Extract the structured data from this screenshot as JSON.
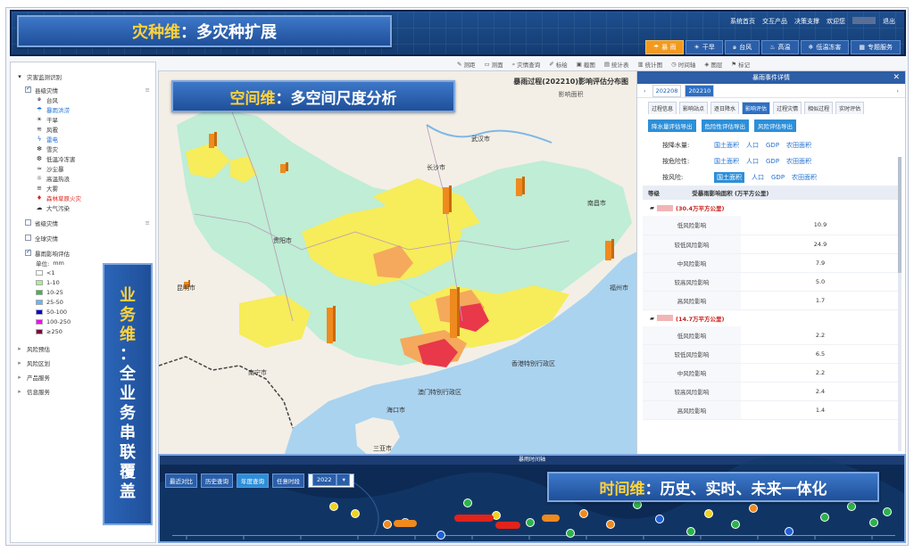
{
  "header": {
    "banner_prefix": "灾种维",
    "banner_colon": "：",
    "banner_text": "多灾种扩展",
    "links": [
      "系统首页",
      "交互产品",
      "决策支撑",
      "欢迎您",
      "退出"
    ],
    "nav": [
      {
        "label": "暴 雨",
        "icon": "rain-icon",
        "active": true
      },
      {
        "label": "干旱",
        "icon": "drought-icon",
        "active": false
      },
      {
        "label": "台风",
        "icon": "typhoon-icon",
        "active": false
      },
      {
        "label": "高温",
        "icon": "thermometer-icon",
        "active": false
      },
      {
        "label": "低温冻害",
        "icon": "snowflake-icon",
        "active": false
      },
      {
        "label": "专题服务",
        "icon": "grid-icon",
        "active": false
      }
    ]
  },
  "toolbar": [
    "测距",
    "测面",
    "灾情查询",
    "标绘",
    "截图",
    "统计表",
    "统计图",
    "时间轴",
    "图层",
    "标记"
  ],
  "left_panel": {
    "root": "灾害监测识别",
    "county_label": "县级灾情",
    "hazards": [
      {
        "icon": "typhoon-icon",
        "label": "台风",
        "color": "#333"
      },
      {
        "icon": "rain-icon",
        "label": "暴雨洪涝",
        "color": "#1e6fd0"
      },
      {
        "icon": "drought-icon",
        "label": "干旱",
        "color": "#333"
      },
      {
        "icon": "wind-icon",
        "label": "风雹",
        "color": "#333"
      },
      {
        "icon": "lightning-icon",
        "label": "雷电",
        "color": "#1e6fd0"
      },
      {
        "icon": "snow-icon",
        "label": "雪灾",
        "color": "#333"
      },
      {
        "icon": "cold-icon",
        "label": "低温冷冻害",
        "color": "#333"
      },
      {
        "icon": "sand-icon",
        "label": "沙尘暴",
        "color": "#333"
      },
      {
        "icon": "heat-icon",
        "label": "高温热浪",
        "color": "#333"
      },
      {
        "icon": "fog-icon",
        "label": "大雾",
        "color": "#333"
      },
      {
        "icon": "fire-icon",
        "label": "森林草原火灾",
        "color": "#e2231a"
      },
      {
        "icon": "pollution-icon",
        "label": "大气污染",
        "color": "#333"
      }
    ],
    "province_label": "省级灾情",
    "national_label": "全球灾情",
    "rain_eval_label": "暴雨影响评估",
    "unit_label": "单位:",
    "unit_value": "mm",
    "legend": [
      {
        "label": "<1",
        "color": "#ffffff"
      },
      {
        "label": "1-10",
        "color": "#a6f28f"
      },
      {
        "label": "10-25",
        "color": "#3dba3d"
      },
      {
        "label": "25-50",
        "color": "#61b8ff"
      },
      {
        "label": "50-100",
        "color": "#0000e1"
      },
      {
        "label": "100-250",
        "color": "#fa00fa"
      },
      {
        "label": "≥250",
        "color": "#800040"
      }
    ],
    "sections": [
      "风险预估",
      "风险区划",
      "产品服务",
      "信息服务"
    ]
  },
  "business_banner": [
    "业",
    "务",
    "维",
    "：",
    "全",
    "业",
    "务",
    "串",
    "联",
    "覆",
    "盖"
  ],
  "space_banner": {
    "prefix": "空间维",
    "colon": "：",
    "text": "多空间尺度分析"
  },
  "map": {
    "title": "暴雨过程(202210)影响评估分布图",
    "subtitle": "影响面积",
    "cities": [
      "武汉市",
      "贵阳市",
      "长沙市",
      "南宁市",
      "香港特别行政区",
      "澳门特别行政区",
      "三亚市",
      "海口市",
      "昆明市",
      "南昌市",
      "福州市"
    ]
  },
  "right_panel": {
    "title": "暴雨事件详情",
    "dates": [
      "202208",
      "202210"
    ],
    "tabs": [
      "过程信息",
      "影响站点",
      "逐日降水",
      "影响评估",
      "过程灾情",
      "相似过程",
      "实时评估"
    ],
    "active_tab": "影响评估",
    "export_buttons": [
      "降水量评估导出",
      "危险性评估导出",
      "风险评估导出"
    ],
    "options": [
      {
        "label": "按降水量:",
        "values": [
          "国土面积",
          "人口",
          "GDP",
          "农田面积"
        ],
        "active": null
      },
      {
        "label": "按危险性:",
        "values": [
          "国土面积",
          "人口",
          "GDP",
          "农田面积"
        ],
        "active": null
      },
      {
        "label": "按风险:",
        "values": [
          "国土面积",
          "人口",
          "GDP",
          "农田面积"
        ],
        "active": 0
      }
    ],
    "table_headers": [
      "等级",
      "受暴雨影响面积 (万平方公里)"
    ],
    "groups": [
      {
        "name": "(30.4万平方公里)",
        "rows": [
          [
            "低风险影响",
            "10.9"
          ],
          [
            "较低风险影响",
            "24.9"
          ],
          [
            "中风险影响",
            "7.9"
          ],
          [
            "较高风险影响",
            "5.0"
          ],
          [
            "高风险影响",
            "1.7"
          ]
        ]
      },
      {
        "name": "(14.7万平方公里)",
        "rows": [
          [
            "低风险影响",
            "2.2"
          ],
          [
            "较低风险影响",
            "6.5"
          ],
          [
            "中风险影响",
            "2.2"
          ],
          [
            "较高风险影响",
            "2.4"
          ],
          [
            "高风险影响",
            "1.4"
          ]
        ]
      }
    ]
  },
  "timeline": {
    "header": "暴雨时间轴",
    "controls": [
      "最近对比",
      "历史查询",
      "年度查询",
      "任意时段"
    ],
    "active_control": "年度查询",
    "year": "2022",
    "banner_prefix": "时间维",
    "banner_colon": "：",
    "banner_text": "历史、实时、未来一体化"
  }
}
